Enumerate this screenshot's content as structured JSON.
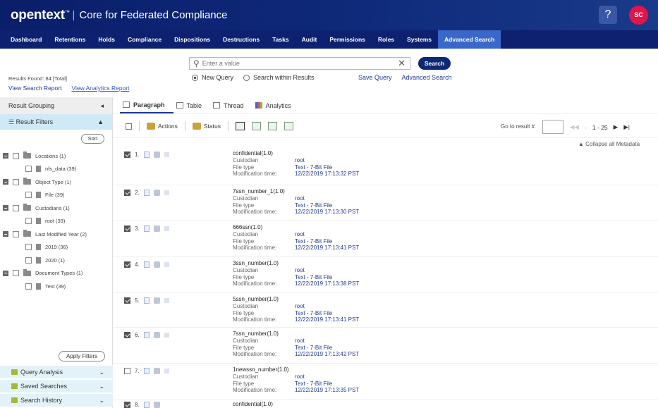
{
  "header": {
    "brand": "opentext",
    "brand_tm": "™",
    "separator": "|",
    "product": "Core for Federated Compliance",
    "help": "?",
    "avatar": "SC"
  },
  "nav": [
    {
      "label": "Dashboard",
      "active": false
    },
    {
      "label": "Retentions",
      "active": false
    },
    {
      "label": "Holds",
      "active": false
    },
    {
      "label": "Compliance",
      "active": false
    },
    {
      "label": "Dispositions",
      "active": false
    },
    {
      "label": "Destructions",
      "active": false
    },
    {
      "label": "Tasks",
      "active": false
    },
    {
      "label": "Audit",
      "active": false
    },
    {
      "label": "Permissions",
      "active": false
    },
    {
      "label": "Roles",
      "active": false
    },
    {
      "label": "Systems",
      "active": false
    },
    {
      "label": "Advanced Search",
      "active": true
    }
  ],
  "search": {
    "placeholder": "Enter a value",
    "button": "Search",
    "clear": "✕",
    "new_query": "New Query",
    "within": "Search within Results",
    "save_query": "Save Query",
    "advanced": "Advanced Search"
  },
  "results": {
    "found": "Results Found: 84 [Total]",
    "view_report": "View Search Report",
    "view_analytics": "View Analytics Report"
  },
  "left": {
    "grouping": "Result Grouping",
    "filters": "Result Filters",
    "sort": "Sort",
    "tree": [
      {
        "level": 0,
        "label": "Locations (1)"
      },
      {
        "level": 1,
        "label": "nfs_data (39)"
      },
      {
        "level": 0,
        "label": "Object Type (1)"
      },
      {
        "level": 1,
        "label": "File (39)"
      },
      {
        "level": 0,
        "label": "Custodians (1)"
      },
      {
        "level": 1,
        "label": "root (39)"
      },
      {
        "level": 0,
        "label": "Last Modified Year (2)"
      },
      {
        "level": 1,
        "label": "2019 (36)"
      },
      {
        "level": 1,
        "label": "2020 (1)"
      },
      {
        "level": 0,
        "label": "Document Types (1)"
      },
      {
        "level": 1,
        "label": "Text (39)"
      }
    ],
    "apply": "Apply Filters",
    "bottom": [
      "Query Analysis",
      "Saved Searches",
      "Search History"
    ]
  },
  "tabs": [
    "Paragraph",
    "Table",
    "Thread",
    "Analytics"
  ],
  "toolbar": {
    "actions": "Actions",
    "status": "Status",
    "goto": "Go to result #",
    "range": "1 - 25",
    "collapse": "▲ Collapse all Metadata"
  },
  "labels": {
    "custodian": "Custodian",
    "file_type": "File type",
    "mod_time": "Modification time:"
  },
  "rows": [
    {
      "num": "1.",
      "checked": true,
      "title": "confidential(1.0)",
      "custodian": "root",
      "file_type": "Text - 7-Bit File",
      "mod_time": "12/22/2019 17:13:32 PST"
    },
    {
      "num": "2.",
      "checked": true,
      "title": "7ssn_number_1(1.0)",
      "custodian": "root",
      "file_type": "Text - 7-Bit File",
      "mod_time": "12/22/2019 17:13:30 PST"
    },
    {
      "num": "3.",
      "checked": true,
      "title": "666ssn(1.0)",
      "custodian": "root",
      "file_type": "Text - 7-Bit File",
      "mod_time": "12/22/2019 17:13:41 PST"
    },
    {
      "num": "4.",
      "checked": true,
      "title": "3ssn_number(1.0)",
      "custodian": "root",
      "file_type": "Text - 7-Bit File",
      "mod_time": "12/22/2019 17:13:38 PST"
    },
    {
      "num": "5.",
      "checked": true,
      "title": "5ssn_number(1.0)",
      "custodian": "root",
      "file_type": "Text - 7-Bit File",
      "mod_time": "12/22/2019 17:13:41 PST"
    },
    {
      "num": "6.",
      "checked": true,
      "title": "7ssn_number(1.0)",
      "custodian": "root",
      "file_type": "Text - 7-Bit File",
      "mod_time": "12/22/2019 17:13:42 PST"
    },
    {
      "num": "7.",
      "checked": false,
      "title": "1newssn_number(1.0)",
      "custodian": "root",
      "file_type": "Text - 7-Bit File",
      "mod_time": "12/22/2019 17:13:35 PST"
    },
    {
      "num": "8.",
      "checked": true,
      "title": "confidential(1.0)",
      "custodian": "",
      "file_type": "",
      "mod_time": ""
    }
  ]
}
